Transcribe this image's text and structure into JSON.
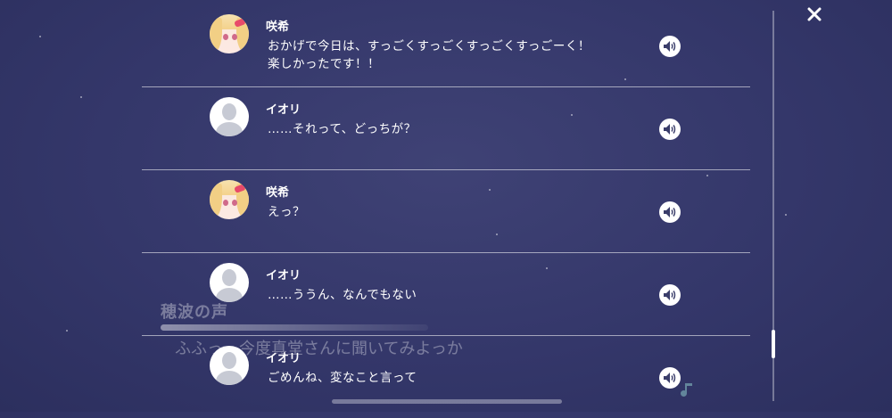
{
  "background": {
    "speaker": "穂波の声",
    "line": "ふふっ、今度真堂さんに聞いてみよっか"
  },
  "log": {
    "entries": [
      {
        "speaker": "咲希",
        "text": "おかげで今日は、すっごくすっごくすっごくすっごーく！\n楽しかったです！！",
        "avatar": "saki"
      },
      {
        "speaker": "イオリ",
        "text": "……それって、どっちが？",
        "avatar": "generic"
      },
      {
        "speaker": "咲希",
        "text": "えっ？",
        "avatar": "saki"
      },
      {
        "speaker": "イオリ",
        "text": "……ううん、なんでもない",
        "avatar": "generic"
      },
      {
        "speaker": "イオリ",
        "text": "ごめんね、変なこと言って",
        "avatar": "generic"
      }
    ]
  },
  "icons": {
    "close": "close-icon",
    "voice": "speaker-icon",
    "note": "music-note-icon"
  }
}
